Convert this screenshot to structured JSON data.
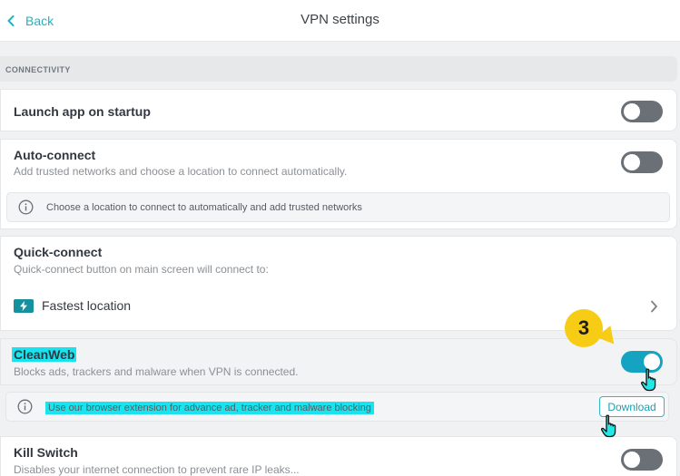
{
  "header": {
    "back_label": "Back",
    "title": "VPN settings"
  },
  "sections": {
    "connectivity": "CONNECTIVITY"
  },
  "launch_on_startup": {
    "title": "Launch app on startup",
    "enabled": false
  },
  "auto_connect": {
    "title": "Auto-connect",
    "description": "Add trusted networks and choose a location to connect automatically.",
    "enabled": false,
    "info": "Choose a location to connect to automatically and add trusted networks"
  },
  "quick_connect": {
    "title": "Quick-connect",
    "description": "Quick-connect button on main screen will connect to:",
    "location": "Fastest location"
  },
  "cleanweb": {
    "title": "CleanWeb",
    "description": "Blocks ads, trackers and malware when VPN is connected.",
    "enabled": true,
    "info": "Use our browser extension for advance ad, tracker and malware blocking",
    "download_label": "Download"
  },
  "kill_switch": {
    "title": "Kill Switch",
    "description": "Disables your internet connection to prevent rare IP leaks...",
    "enabled": false
  },
  "annotation": {
    "step": "3"
  },
  "colors": {
    "accent": "#1fb4c4",
    "toggle_on": "#14a4c2",
    "toggle_off": "#6b7077",
    "highlight": "#19e3ee",
    "step_badge": "#f6cc15"
  },
  "icons": [
    "chevron-left-icon",
    "info-icon",
    "lightning-icon",
    "chevron-right-icon",
    "pointer-hand-icon"
  ]
}
